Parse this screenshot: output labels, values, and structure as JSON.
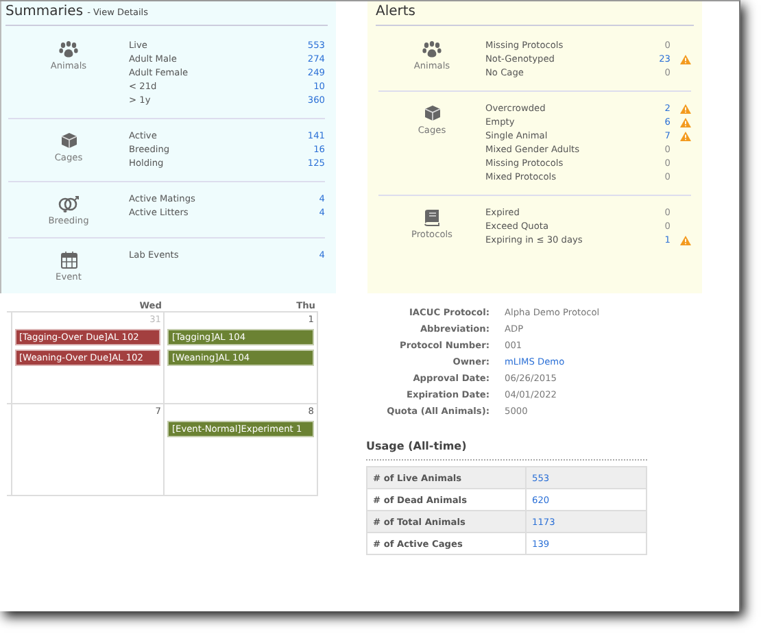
{
  "summaries": {
    "title": "Summaries",
    "link": "- View Details",
    "groups": [
      {
        "kind": "paw",
        "label": "Animals",
        "rows": [
          {
            "label": "Live",
            "value": "553"
          },
          {
            "label": "Adult Male",
            "value": "274"
          },
          {
            "label": "Adult Female",
            "value": "249"
          },
          {
            "label": "< 21d",
            "value": "10"
          },
          {
            "label": "> 1y",
            "value": "360"
          }
        ]
      },
      {
        "kind": "cube",
        "label": "Cages",
        "rows": [
          {
            "label": "Active",
            "value": "141"
          },
          {
            "label": "Breeding",
            "value": "16"
          },
          {
            "label": "Holding",
            "value": "125"
          }
        ]
      },
      {
        "kind": "rings",
        "label": "Breeding",
        "rows": [
          {
            "label": "Active Matings",
            "value": "4"
          },
          {
            "label": "Active Litters",
            "value": "4"
          }
        ]
      },
      {
        "kind": "calendar",
        "label": "Event",
        "rows": [
          {
            "label": "Lab Events",
            "value": "4"
          }
        ]
      }
    ]
  },
  "alerts": {
    "title": "Alerts",
    "groups": [
      {
        "kind": "paw",
        "label": "Animals",
        "rows": [
          {
            "label": "Missing Protocols",
            "value": "0",
            "warning": false
          },
          {
            "label": "Not-Genotyped",
            "value": "23",
            "warning": true
          },
          {
            "label": "No Cage",
            "value": "0",
            "warning": false
          }
        ]
      },
      {
        "kind": "cube",
        "label": "Cages",
        "rows": [
          {
            "label": "Overcrowded",
            "value": "2",
            "warning": true
          },
          {
            "label": "Empty",
            "value": "6",
            "warning": true
          },
          {
            "label": "Single Animal",
            "value": "7",
            "warning": true
          },
          {
            "label": "Mixed Gender Adults",
            "value": "0",
            "warning": false
          },
          {
            "label": "Missing Protocols",
            "value": "0",
            "warning": false
          },
          {
            "label": "Mixed Protocols",
            "value": "0",
            "warning": false
          }
        ]
      },
      {
        "kind": "book",
        "label": "Protocols",
        "rows": [
          {
            "label": "Expired",
            "value": "0",
            "warning": false
          },
          {
            "label": "Exceed Quota",
            "value": "0",
            "warning": false
          },
          {
            "label": "Expiring in ≤ 30 days",
            "value": "1",
            "warning": true
          }
        ]
      }
    ]
  },
  "calendar": {
    "days": [
      "Wed",
      "Thu"
    ],
    "weeks": [
      {
        "cells": [
          {
            "date": "31",
            "muted": true,
            "events": [
              {
                "label": "[Tagging-Over Due]AL 102",
                "color": "#a33f3f"
              },
              {
                "label": "[Weaning-Over Due]AL 102",
                "color": "#a33f3f"
              }
            ]
          },
          {
            "date": "1",
            "muted": false,
            "events": [
              {
                "label": "[Tagging]AL 104",
                "color": "#6b8233"
              },
              {
                "label": "[Weaning]AL 104",
                "color": "#6b8233"
              }
            ]
          }
        ]
      },
      {
        "cells": [
          {
            "date": "7",
            "muted": false
          },
          {
            "date": "8",
            "muted": false,
            "events": [
              {
                "label": "[Event-Normal]Experiment 1",
                "color": "#6b8233"
              }
            ]
          }
        ]
      }
    ]
  },
  "protocol": {
    "fields": [
      {
        "label": "IACUC Protocol:",
        "value": "Alpha Demo Protocol",
        "link": false
      },
      {
        "label": "Abbreviation:",
        "value": "ADP",
        "link": false
      },
      {
        "label": "Protocol Number:",
        "value": "001",
        "link": false
      },
      {
        "label": "Owner:",
        "value": "mLIMS Demo",
        "link": true
      },
      {
        "label": "Approval Date:",
        "value": "06/26/2015",
        "link": false
      },
      {
        "label": "Expiration Date:",
        "value": "04/01/2022",
        "link": false
      },
      {
        "label": "Quota (All Animals):",
        "value": "5000",
        "link": false
      }
    ]
  },
  "usage": {
    "title": "Usage (All-time)",
    "rows": [
      {
        "label": "# of Live Animals",
        "value": "553"
      },
      {
        "label": "# of Dead Animals",
        "value": "620"
      },
      {
        "label": "# of Total Animals",
        "value": "1173"
      },
      {
        "label": "# of Active Cages",
        "value": "139"
      }
    ]
  }
}
